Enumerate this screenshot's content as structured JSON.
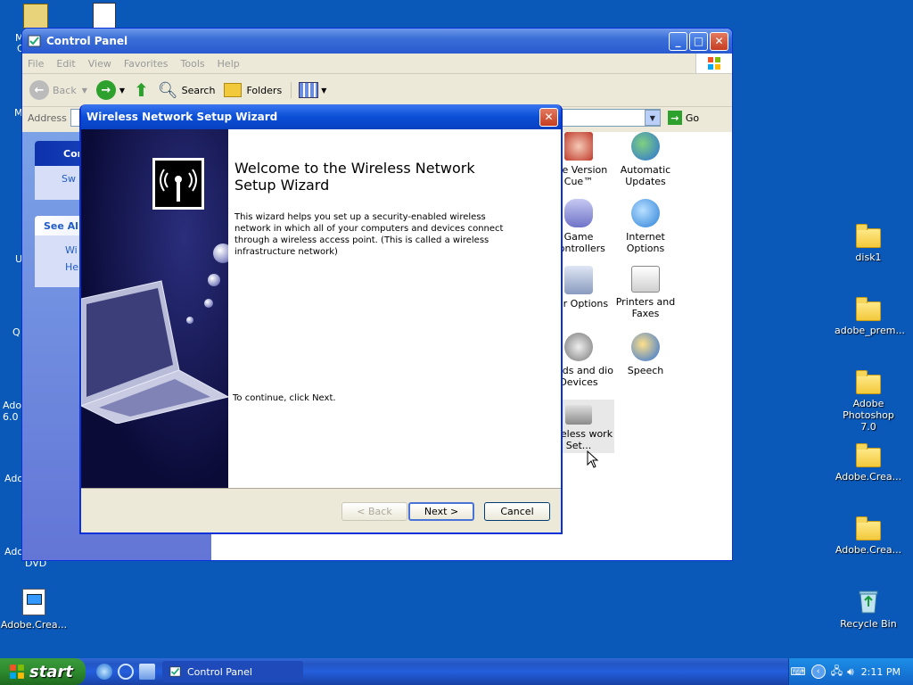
{
  "desktop": {
    "icons_right": [
      {
        "label": "disk1",
        "kind": "folder"
      },
      {
        "label": "adobe_prem...",
        "kind": "folder"
      },
      {
        "label": "Adobe Photoshop 7.0",
        "kind": "folder"
      },
      {
        "label": "Adobe.Crea...",
        "kind": "folder"
      },
      {
        "label": "Adobe.Crea...",
        "kind": "folder"
      },
      {
        "label": "Recycle Bin",
        "kind": "recycle-bin"
      }
    ],
    "icons_left_visible_labels": [
      "M",
      "C",
      "M",
      "U",
      "Q",
      "Ado",
      "6.0",
      "Ado",
      "Ado",
      "DVD"
    ],
    "icon_bottom_left": {
      "label": "Adobe.Crea..."
    }
  },
  "control_panel": {
    "title": "Control Panel",
    "menu": [
      "File",
      "Edit",
      "View",
      "Favorites",
      "Tools",
      "Help"
    ],
    "toolbar": {
      "back": "Back",
      "search": "Search",
      "folders": "Folders"
    },
    "address_label": "Address",
    "go_label": "Go",
    "leftpane": {
      "section1_title": "Con",
      "section1_item": "Sw",
      "see_also_title": "See Al",
      "see_also_items": [
        "Wi",
        "He"
      ]
    },
    "icons": [
      {
        "label": "obe Version Cue™",
        "icon": "adobe-version-cue-icon"
      },
      {
        "label": "Automatic Updates",
        "icon": "automatic-updates-icon"
      },
      {
        "label": "Game Controllers",
        "icon": "game-controllers-icon"
      },
      {
        "label": "Internet Options",
        "icon": "internet-options-icon"
      },
      {
        "label": "wer Options",
        "icon": "power-options-icon"
      },
      {
        "label": "Printers and Faxes",
        "icon": "printers-icon"
      },
      {
        "label": "ounds and dio Devices",
        "icon": "sounds-icon"
      },
      {
        "label": "Speech",
        "icon": "speech-icon"
      },
      {
        "label": "Wireless work Set...",
        "icon": "wireless-network-icon"
      }
    ]
  },
  "wizard": {
    "title": "Wireless Network Setup Wizard",
    "heading": "Welcome to the Wireless Network Setup Wizard",
    "body": "This wizard helps you set up a security-enabled wireless network in which all of your computers and devices connect through a wireless access point. (This is called a wireless infrastructure network)",
    "continue_text": "To continue, click Next.",
    "buttons": {
      "back": "< Back",
      "next": "Next >",
      "cancel": "Cancel"
    }
  },
  "taskbar": {
    "start_label": "start",
    "task_button": "Control Panel",
    "clock": "2:11 PM"
  },
  "colors": {
    "desktop": "#0a58b8",
    "titlebar": "#0a4fd6",
    "start_green": "#2d8a2d"
  }
}
